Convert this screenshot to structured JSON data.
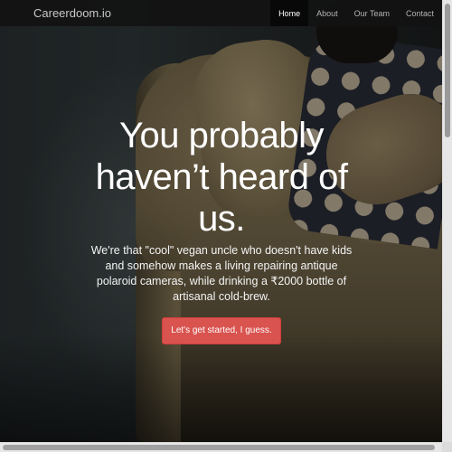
{
  "navbar": {
    "brand": "Careerdoom.io",
    "links": [
      {
        "label": "Home",
        "active": true
      },
      {
        "label": "About",
        "active": false
      },
      {
        "label": "Our Team",
        "active": false
      },
      {
        "label": "Contact",
        "active": false
      }
    ]
  },
  "hero": {
    "headline_lines": [
      "You probably",
      "haven’t heard of",
      "us."
    ],
    "tagline": "We're that \"cool\" vegan uncle who doesn't have kids and somehow makes a living repairing antique polaroid cameras, while drinking a ₹2000 bottle of artisanal cold-brew.",
    "cta_label": "Let's get started, I guess."
  },
  "colors": {
    "accent": "#d9534f",
    "navbar_bg": "#121212",
    "active_nav_bg": "#080808"
  }
}
